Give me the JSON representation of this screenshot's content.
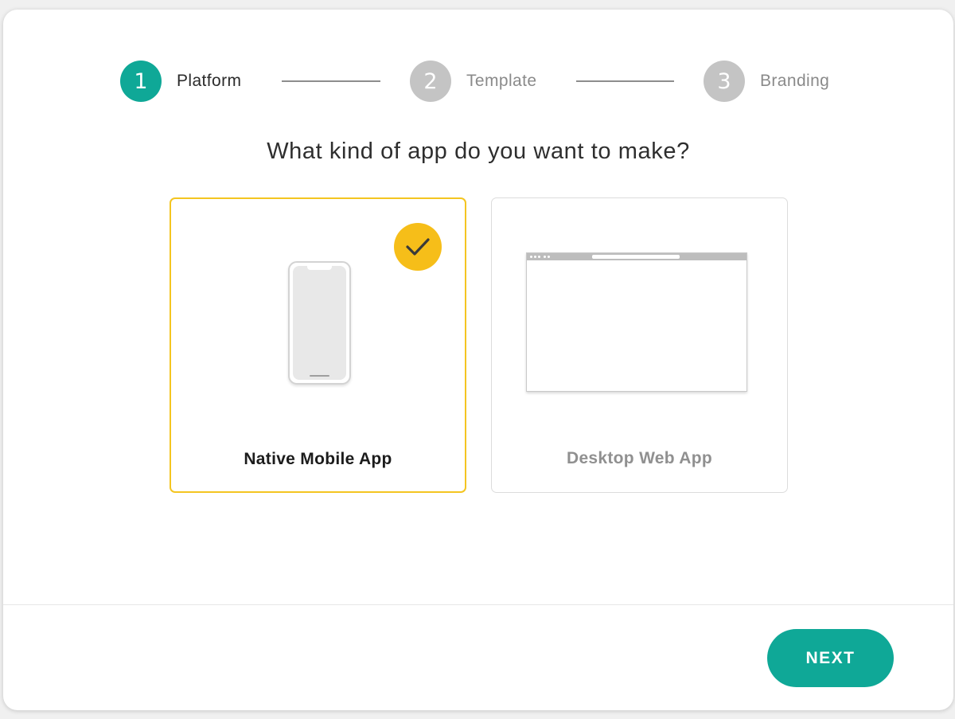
{
  "stepper": {
    "steps": [
      {
        "number": "1",
        "label": "Platform",
        "state": "active"
      },
      {
        "number": "2",
        "label": "Template",
        "state": "inactive"
      },
      {
        "number": "3",
        "label": "Branding",
        "state": "inactive"
      }
    ]
  },
  "question": "What kind of app do you want to make?",
  "options": [
    {
      "label": "Native Mobile App",
      "selected": true,
      "icon": "phone-icon"
    },
    {
      "label": "Desktop Web App",
      "selected": false,
      "icon": "browser-window-icon"
    }
  ],
  "footer": {
    "next_label": "NEXT"
  },
  "colors": {
    "accent": "#0fa897",
    "selected_border": "#f4c521",
    "check_badge": "#f6be19",
    "inactive_step": "#c4c4c4"
  }
}
